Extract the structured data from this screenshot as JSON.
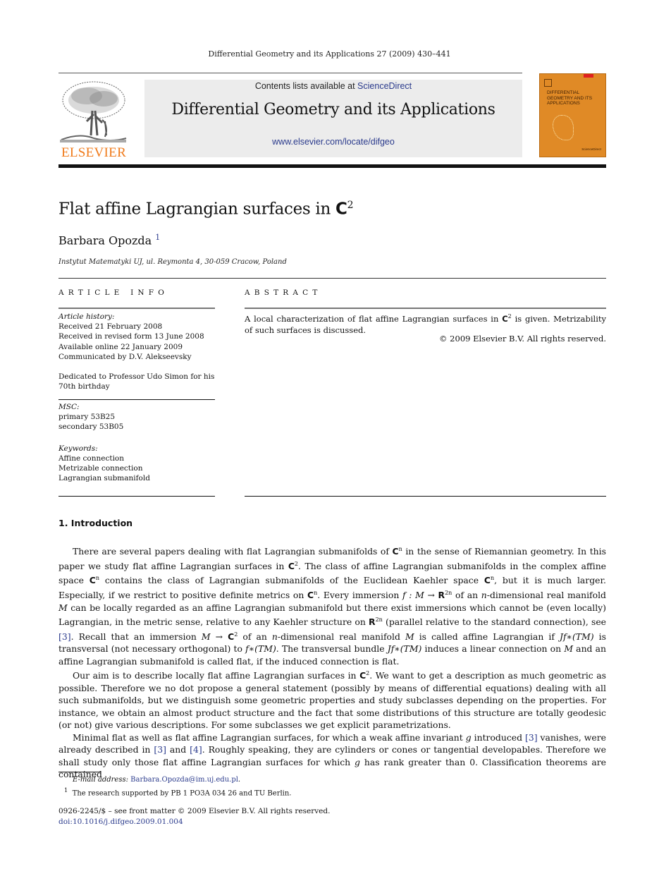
{
  "header": {
    "running_head": "Differential Geometry and its Applications 27 (2009) 430–441",
    "publisher_logo_text": "ELSEVIER",
    "contents_prefix": "Contents lists available at ",
    "contents_link": "ScienceDirect",
    "journal_title": "Differential Geometry and its Applications",
    "journal_url": "www.elsevier.com/locate/difgeo",
    "cover": {
      "title_lines": [
        "DIFFERENTIAL",
        "GEOMETRY AND ITS",
        "APPLICATIONS"
      ],
      "footer": "ScienceDirect",
      "color": "#e08a26"
    }
  },
  "article": {
    "title": "Flat affine Lagrangian surfaces in ",
    "title_math": "C",
    "title_sup": "2",
    "author": "Barbara Opozda",
    "author_sup": "1",
    "affiliation": "Instytut Matematyki UJ, ul. Reymonta 4, 30-059 Cracow, Poland"
  },
  "article_info": {
    "label": "ARTICLE INFO",
    "history_label": "Article history:",
    "history": [
      "Received 21 February 2008",
      "Received in revised form 13 June 2008",
      "Available online 22 January 2009",
      "Communicated by D.V. Alekseevsky"
    ],
    "dedication": [
      "Dedicated to Professor Udo Simon for his",
      "70th birthday"
    ],
    "msc_label": "MSC:",
    "msc": [
      "primary 53B25",
      "secondary 53B05"
    ],
    "keywords_label": "Keywords:",
    "keywords": [
      "Affine connection",
      "Metrizable connection",
      "Lagrangian submanifold"
    ]
  },
  "abstract": {
    "label": "ABSTRACT",
    "text_1": "A local characterization of flat affine Lagrangian surfaces in ",
    "math": "C",
    "sup": "2",
    "text_2": " is given. Metrizability of such surfaces is discussed.",
    "copyright": "© 2009 Elsevier B.V. All rights reserved."
  },
  "section": {
    "heading": "1.  Introduction",
    "p1": [
      "There are several papers dealing with flat Lagrangian submanifolds of ",
      "C",
      "n",
      " in the sense of Riemannian geometry. In this paper we study flat affine Lagrangian surfaces in ",
      "C",
      "2",
      ". The class of affine Lagrangian submanifolds in the complex affine space ",
      "C",
      "n",
      " contains the class of Lagrangian submanifolds of the Euclidean Kaehler space ",
      "C",
      "n",
      ", but it is much larger. Especially, if we restrict to positive definite metrics on ",
      "C",
      "n",
      ". Every immersion ",
      "f : M → ",
      "R",
      "2n",
      " of an ",
      "n",
      "-dimensional real manifold ",
      "M",
      " can be locally regarded as an affine Lagrangian submanifold but there exist immersions which cannot be (even locally) Lagrangian, in the metric sense, relative to any Kaehler structure on ",
      "R",
      "2n",
      " (parallel relative to the standard connection), see ",
      "[3]",
      ". Recall that an immersion ",
      "M → ",
      "C",
      "2",
      " of an ",
      "n",
      "-dimensional real manifold ",
      "M",
      " is called affine Lagrangian if ",
      "Jf∗(TM)",
      " is transversal (not necessary orthogonal) to ",
      "f∗(TM)",
      ". The transversal bundle ",
      "Jf∗(TM)",
      " induces a linear connection on ",
      "M",
      " and an affine Lagrangian submanifold is called flat, if the induced connection is flat."
    ],
    "p2": [
      "Our aim is to describe locally flat affine Lagrangian surfaces in ",
      "C",
      "2",
      ". We want to get a description as much geometric as possible. Therefore we no dot propose a general statement (possibly by means of differential equations) dealing with all such submanifolds, but we distinguish some geometric properties and study subclasses depending on the properties. For instance, we obtain an almost product structure and the fact that some distributions of this structure are totally geodesic (or not) give various descriptions. For some subclasses we get explicit parametrizations."
    ],
    "p3": [
      "Minimal flat as well as flat affine Lagrangian surfaces, for which a weak affine invariant ",
      "g",
      " introduced ",
      "[3]",
      " vanishes, were already described in ",
      "[3]",
      " and ",
      "[4]",
      ". Roughly speaking, they are cylinders or cones or tangential developables. Therefore we shall study only those flat affine Lagrangian surfaces for which ",
      "g",
      " has rank greater than 0. Classification theorems are contained"
    ]
  },
  "footnotes": {
    "email_label": "E-mail address: ",
    "email": "Barbara.Opozda@im.uj.edu.pl",
    "email_suffix": ".",
    "note_mark": "1",
    "note_text": "The research supported by PB 1 PO3A 034 26 and TU Berlin."
  },
  "front_matter": {
    "issn_line": "0926-2245/$ – see front matter  © 2009 Elsevier B.V. All rights reserved.",
    "doi": "doi:10.1016/j.difgeo.2009.01.004"
  },
  "colors": {
    "link": "#2a3a8c",
    "elsevier_orange": "#f07a1a",
    "banner_bg": "#ececec"
  }
}
